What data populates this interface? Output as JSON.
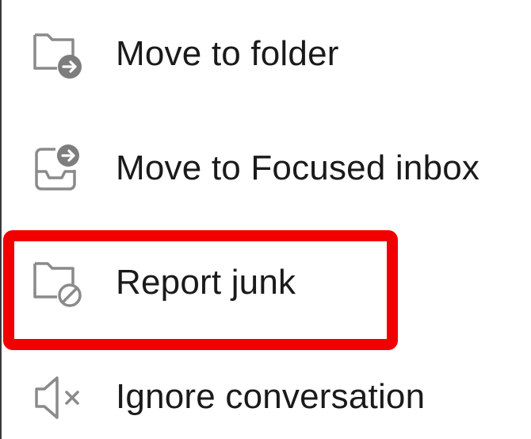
{
  "menu": {
    "items": [
      {
        "label": "Move to folder",
        "icon": "folder-move-icon"
      },
      {
        "label": "Move to Focused inbox",
        "icon": "inbox-move-icon"
      },
      {
        "label": "Report junk",
        "icon": "folder-block-icon"
      },
      {
        "label": "Ignore conversation",
        "icon": "speaker-mute-icon"
      }
    ]
  },
  "colors": {
    "icon": "#8a8a8a",
    "text": "#1a1a1a",
    "highlight": "#f20000"
  }
}
